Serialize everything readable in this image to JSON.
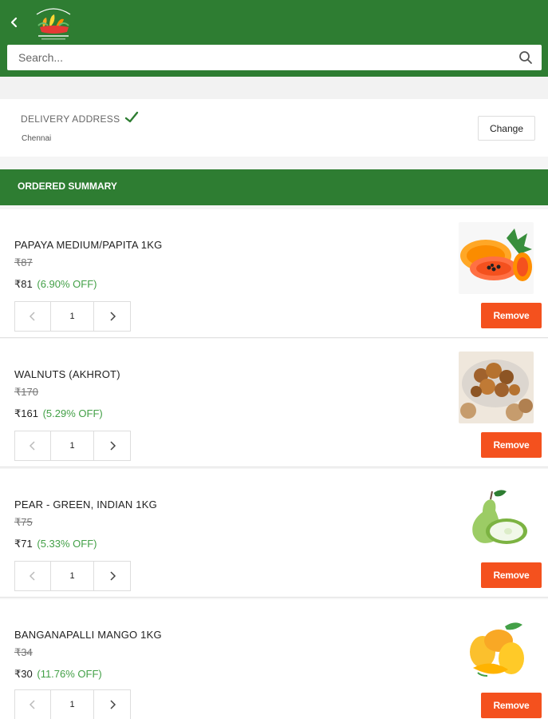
{
  "header": {
    "logo_name": "fresh-farm-logo",
    "search": {
      "placeholder": "Search..."
    }
  },
  "delivery": {
    "title": "DELIVERY ADDRESS",
    "city": "Chennai",
    "change_label": "Change"
  },
  "summary": {
    "title": "ORDERED SUMMARY"
  },
  "colors": {
    "brand_green": "#2e7d32",
    "remove_orange": "#f4511e",
    "discount_green": "#43a047"
  },
  "items": [
    {
      "name": "PAPAYA MEDIUM/PAPITA 1KG",
      "mrp": "₹87",
      "price": "₹81",
      "discount": "(6.90% OFF)",
      "quantity": "1",
      "remove_label": "Remove",
      "image_icon": "papaya-image"
    },
    {
      "name": "WALNUTS (AKHROT)",
      "mrp": "₹170",
      "price": "₹161",
      "discount": "(5.29% OFF)",
      "quantity": "1",
      "remove_label": "Remove",
      "image_icon": "walnuts-image"
    },
    {
      "name": "PEAR - GREEN, INDIAN 1KG",
      "mrp": "₹75",
      "price": "₹71",
      "discount": "(5.33% OFF)",
      "quantity": "1",
      "remove_label": "Remove",
      "image_icon": "pear-image"
    },
    {
      "name": "BANGANAPALLI MANGO 1KG",
      "mrp": "₹34",
      "price": "₹30",
      "discount": "(11.76% OFF)",
      "quantity": "1",
      "remove_label": "Remove",
      "image_icon": "mango-image"
    }
  ]
}
